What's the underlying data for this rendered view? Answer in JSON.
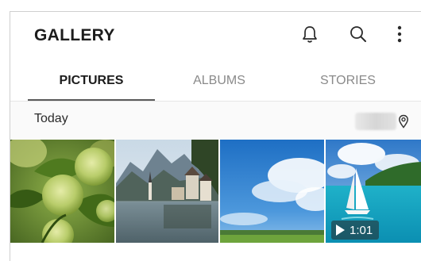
{
  "app": {
    "title": "GALLERY"
  },
  "actions": [
    {
      "name": "notifications",
      "icon": "bell-icon"
    },
    {
      "name": "search",
      "icon": "search-icon"
    },
    {
      "name": "more-options",
      "icon": "more-vertical-icon"
    }
  ],
  "tabs": [
    {
      "label": "PICTURES",
      "active": true
    },
    {
      "label": "ALBUMS",
      "active": false
    },
    {
      "label": "STORIES",
      "active": false
    }
  ],
  "section": {
    "date_label": "Today",
    "location_icon": "location-pin-icon"
  },
  "thumbnails": [
    {
      "subject": "green hydrangea flowers",
      "type": "image"
    },
    {
      "subject": "lakeside alpine village",
      "type": "image"
    },
    {
      "subject": "blue sky with clouds over field",
      "type": "image"
    },
    {
      "subject": "sailboat on turquoise sea",
      "type": "video",
      "duration": "1:01"
    }
  ],
  "colors": {
    "accent_text": "#1c1c1c",
    "inactive_tab": "#8a8a8a",
    "indicator": "#5a5a5a"
  }
}
